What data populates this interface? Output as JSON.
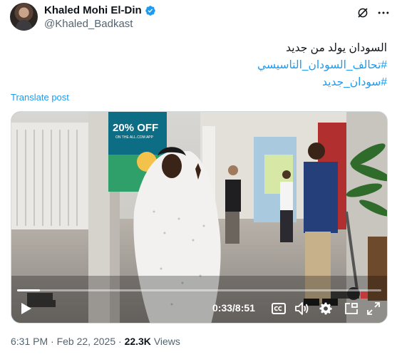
{
  "author": {
    "display_name": "Khaled Mohi El-Din",
    "handle": "@Khaled_Badkast",
    "verified": true
  },
  "tweet": {
    "line1": "السودان يولد من جديد",
    "hashtag1": "#تحالف_السودان_التاسيسي",
    "hashtag2": "#سودان_جديد"
  },
  "translate_label": "Translate post",
  "video": {
    "current_time": "0:33",
    "separator": " / ",
    "duration": "8:51",
    "progress_fraction": 0.062,
    "billboard_text": "20% OFF",
    "billboard_sub": "ON THE ALL.COM APP"
  },
  "footer": {
    "time": "6:31 PM",
    "dot": " · ",
    "date": "Feb 22, 2025",
    "views_count": "22.3K",
    "views_label": "Views"
  },
  "colors": {
    "accent": "#1d9bf0",
    "muted": "#536471"
  },
  "icons": {
    "verified": "verified-badge-icon",
    "grok": "grok-icon",
    "more": "more-options-icon",
    "play": "play-icon",
    "captions": "captions-icon",
    "volume": "volume-icon",
    "settings": "settings-gear-icon",
    "pip": "picture-in-picture-icon",
    "fullscreen": "fullscreen-icon"
  }
}
